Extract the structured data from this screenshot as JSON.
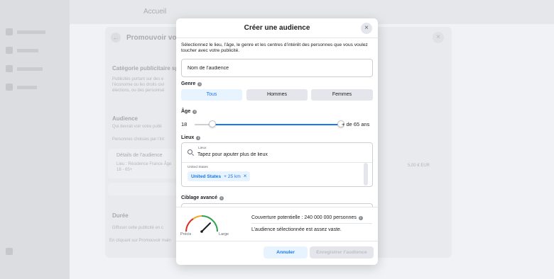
{
  "modal": {
    "title": "Créer une audience",
    "description": "Sélectionnez le lieu, l’âge, le genre et les centres d’intérêt des personnes que vous voulez toucher avec votre publicité.",
    "audience_name": {
      "value": "",
      "placeholder": "Nom de l’audience"
    },
    "gender": {
      "label": "Genre",
      "options": [
        "Tous",
        "Hommes",
        "Femmes"
      ],
      "selected": "Tous"
    },
    "age": {
      "label": "Âge",
      "min": "18",
      "max": "+ de 65 ans",
      "range_fraction": [
        0.12,
        1.0
      ]
    },
    "locations": {
      "label": "Lieux",
      "field_label": "Lieux",
      "placeholder": "Tapez pour ajouter plus de lieux",
      "country": "United States",
      "chip": {
        "name": "United States",
        "radius": "+ 25 km",
        "remove": "×"
      }
    },
    "advanced_label": "Ciblage avancé",
    "reach": {
      "coverage": "Couverture potentielle : 240 000 000 personnes",
      "status": "L’audience sélectionnée est assez vaste.",
      "gauge_left": "Précis",
      "gauge_right": "Large"
    },
    "buttons": {
      "cancel": "Annuler",
      "save": "Enregistrer l’audience"
    },
    "close_glyph": "×"
  },
  "background": {
    "topbar_title": "Accueil",
    "panel_title": "Promouvoir vot",
    "back_glyph": "←",
    "sections": {
      "category_title": "Catégorie publicitaire sp",
      "category_text": "Publicités portant sur des e l’économie ou les droits civi élections, ou des personnal",
      "audience_title": "Audience",
      "audience_sub": "Qui devrait voir votre publi",
      "audience_people": "Personnes choisies par l’int",
      "details_title": "Détails de l’audience",
      "details_text": "Lieu : Résidence France Âge 18 - 65+",
      "duration_title": "Durée",
      "duration_text": "Diffuser cette publicité en c",
      "terms": "En cliquant sur Promouvoir main"
    },
    "right_amount": "5,00 € EUR",
    "close_glyph": "×"
  },
  "colors": {
    "accent": "#1877f2",
    "accent_light": "#e7f3ff",
    "neutral": "#e4e6eb"
  }
}
